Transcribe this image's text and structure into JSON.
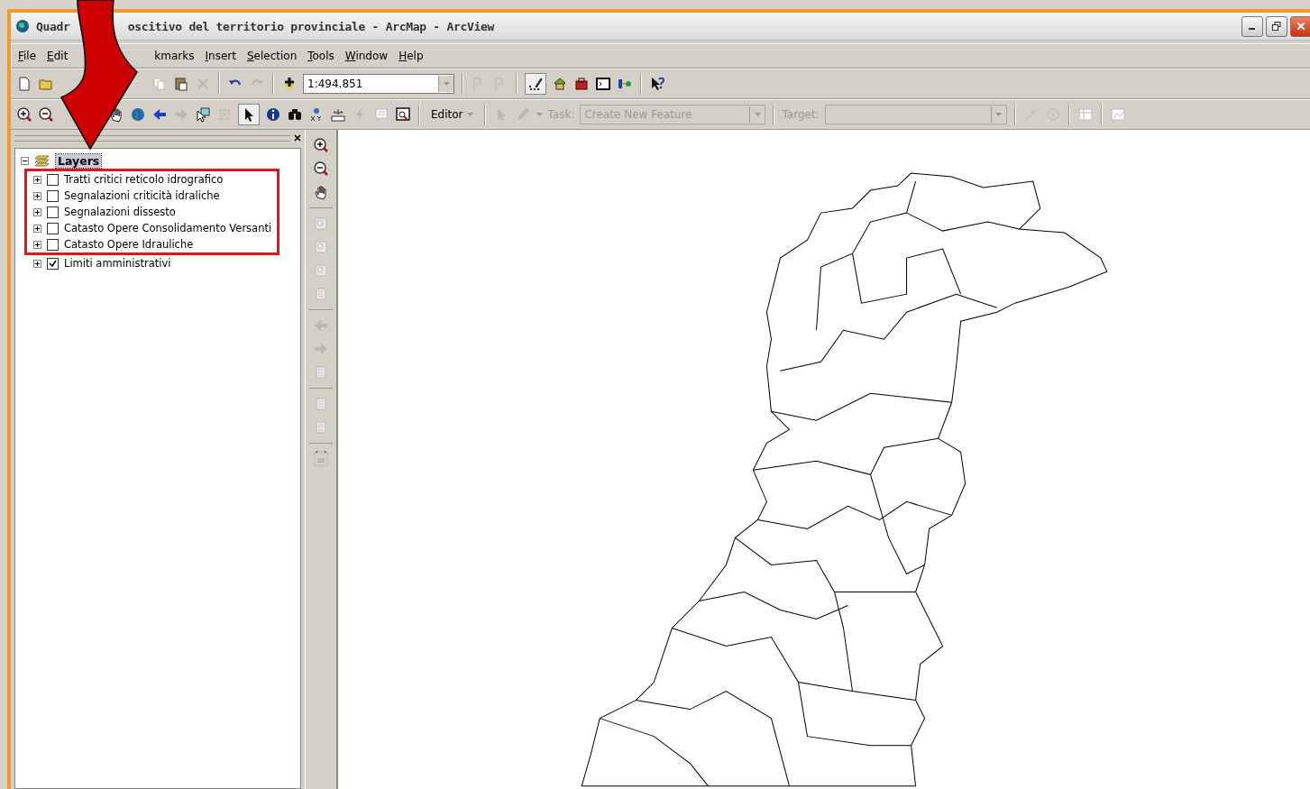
{
  "window": {
    "title_parts": [
      "Quadr",
      "oscitivo del territorio provinciale - ArcMap - ArcView"
    ]
  },
  "menu_before_overlay": [
    {
      "label": "File",
      "mnemonic": true
    },
    {
      "label": "Edit",
      "mnemonic": true
    }
  ],
  "menu_after_overlay": [
    {
      "label": "kmarks",
      "mnemonic": false
    },
    {
      "label": "Insert",
      "mnemonic": true
    },
    {
      "label": "Selection",
      "mnemonic": true
    },
    {
      "label": "Tools",
      "mnemonic": true
    },
    {
      "label": "Window",
      "mnemonic": true
    },
    {
      "label": "Help",
      "mnemonic": true
    }
  ],
  "standard_toolbar": {
    "scale": "1:494.851"
  },
  "editor_toolbar": {
    "editor_label": "Editor",
    "task_label": "Task:",
    "task_value": "Create New Feature",
    "target_label": "Target:",
    "disabled": true
  },
  "toc": {
    "root": {
      "label": "Layers",
      "expanded": true,
      "selected": true,
      "children": [
        {
          "label": "Tratti critici reticolo idrografico",
          "checked": false,
          "expanded": false,
          "highlighted": true
        },
        {
          "label": "Segnalazioni criticità idraliche",
          "checked": false,
          "expanded": false,
          "highlighted": true
        },
        {
          "label": "Segnalazioni dissesto",
          "checked": false,
          "expanded": false,
          "highlighted": true
        },
        {
          "label": "Catasto Opere Consolidamento Versanti",
          "checked": false,
          "expanded": false,
          "highlighted": true
        },
        {
          "label": "Catasto Opere Idrauliche",
          "checked": false,
          "expanded": false,
          "highlighted": true
        },
        {
          "label": "Limiti amministrativi",
          "checked": true,
          "expanded": false,
          "highlighted": false
        }
      ]
    }
  }
}
